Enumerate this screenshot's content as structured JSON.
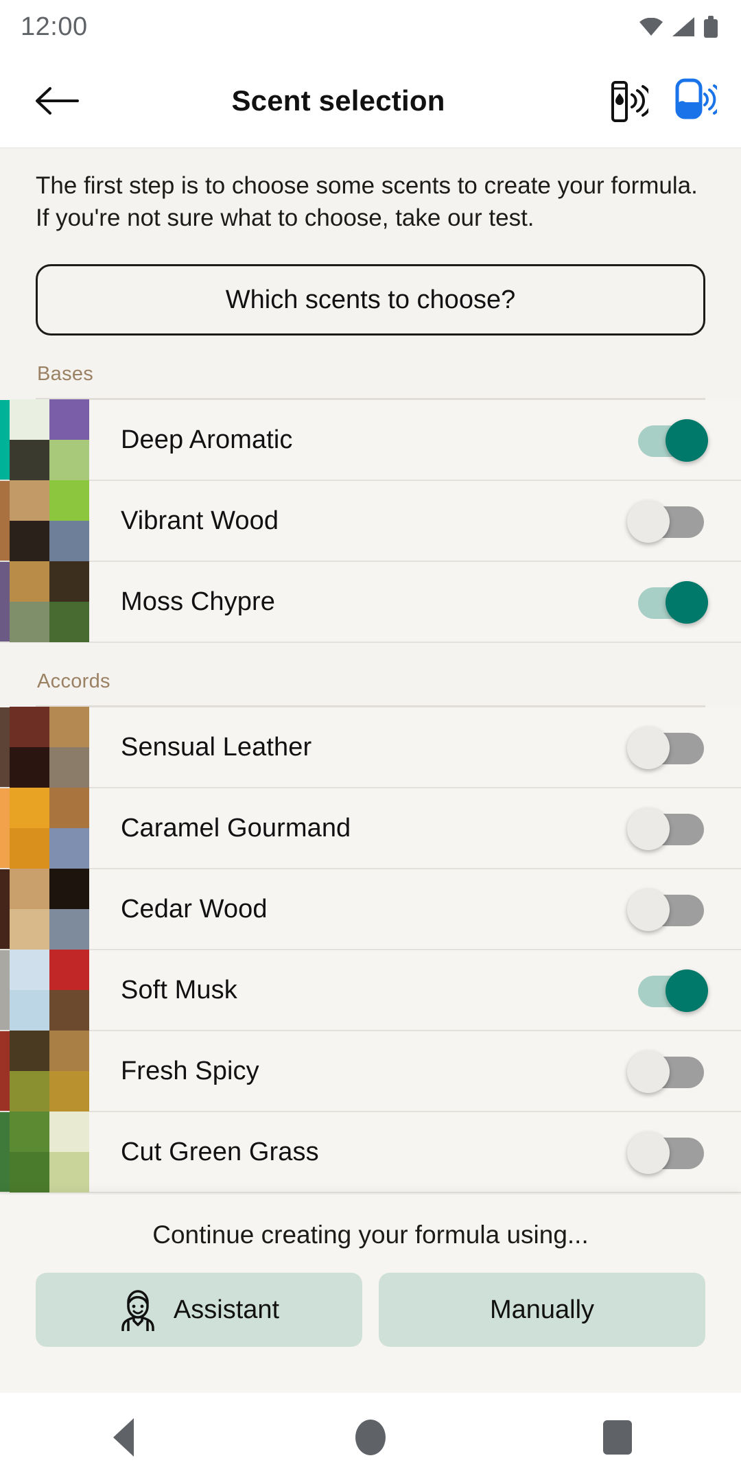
{
  "status_bar": {
    "time": "12:00",
    "icons": [
      "wifi-icon",
      "cellular-signal-icon",
      "battery-icon"
    ]
  },
  "app_bar": {
    "back_icon": "back-arrow-icon",
    "title": "Scent selection",
    "device_icon": "perfume-device-connect-icon",
    "bottle_icon": "bottle-connect-icon",
    "bottle_icon_color": "#1a73e8"
  },
  "intro": {
    "text": "The first step is to choose some scents to create your formula. If you're not sure what to choose, take our test.",
    "help_button": "Which scents to choose?"
  },
  "theme": {
    "accent_on": "#00786a",
    "track_on": "#a8cfc5",
    "track_off": "#9e9e9e",
    "section_label": "#9a8163",
    "page_bg": "#f5f3f0",
    "button_bg": "#cfe0d8"
  },
  "sections": [
    {
      "label": "Bases",
      "items": [
        {
          "name": "Deep Aromatic",
          "enabled": true,
          "accent": "#00b398",
          "tiles": [
            "#e9f0e2",
            "#7b5ea8",
            "#3b3a2e",
            "#a8c97a"
          ]
        },
        {
          "name": "Vibrant Wood",
          "enabled": false,
          "accent": "#a9713f",
          "tiles": [
            "#c29a67",
            "#8cc63f",
            "#2a211b",
            "#6d7f99"
          ]
        },
        {
          "name": "Moss Chypre",
          "enabled": true,
          "accent": "#6b5b84",
          "tiles": [
            "#b98d47",
            "#3c2f1e",
            "#7f8f6a",
            "#486b32"
          ]
        }
      ]
    },
    {
      "label": "Accords",
      "items": [
        {
          "name": "Sensual Leather",
          "enabled": false,
          "accent": "#5c4336",
          "tiles": [
            "#6d2f24",
            "#b58a52",
            "#2a1510",
            "#8a7c68"
          ]
        },
        {
          "name": "Caramel Gourmand",
          "enabled": false,
          "accent": "#f2a24a",
          "tiles": [
            "#e8a324",
            "#a9743e",
            "#d9901d",
            "#7f8fb0"
          ]
        },
        {
          "name": "Cedar Wood",
          "enabled": false,
          "accent": "#45241a",
          "tiles": [
            "#c9a06b",
            "#1d140e",
            "#d8b98a",
            "#7d8b9c"
          ]
        },
        {
          "name": "Soft Musk",
          "enabled": true,
          "accent": "#a9a8a3",
          "tiles": [
            "#cfe0ec",
            "#c22727",
            "#bcd6e6",
            "#6b4a2d"
          ]
        },
        {
          "name": "Fresh Spicy",
          "enabled": false,
          "accent": "#9c3126",
          "tiles": [
            "#4a3a22",
            "#a97f45",
            "#8a9030",
            "#b9922f"
          ]
        },
        {
          "name": "Cut Green Grass",
          "enabled": false,
          "accent": "#3f7a3a",
          "tiles": [
            "#5c8a33",
            "#e8ead2",
            "#4a7a2c",
            "#c8d49a"
          ]
        }
      ]
    }
  ],
  "bottom_sheet": {
    "title": "Continue creating your formula using...",
    "assistant_button": "Assistant",
    "assistant_icon": "assistant-avatar-icon",
    "manual_button": "Manually"
  },
  "nav_bar": {
    "back": "nav-back-icon",
    "home": "nav-home-icon",
    "recents": "nav-recents-icon"
  }
}
